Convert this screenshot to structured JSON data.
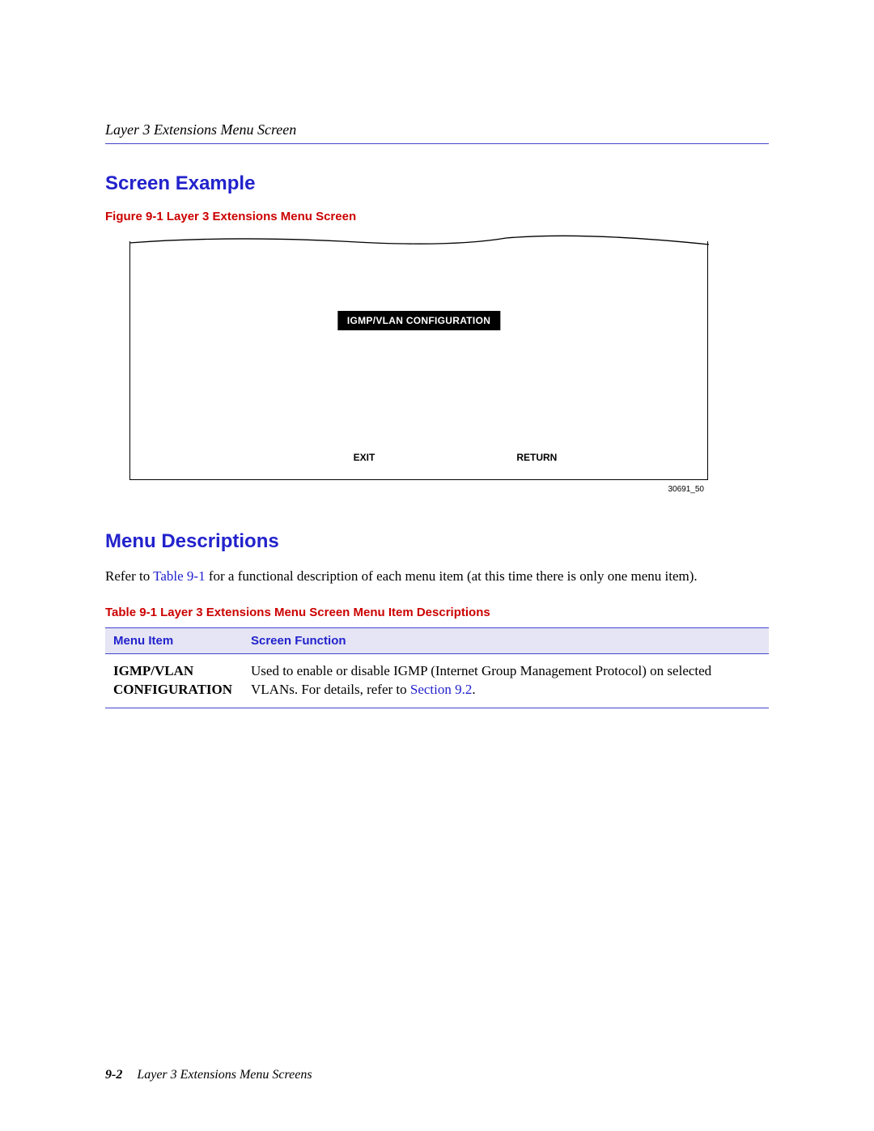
{
  "header": {
    "running_head": "Layer 3 Extensions Menu Screen"
  },
  "sections": {
    "screen_example": {
      "heading": "Screen Example",
      "figure_caption": "Figure 9-1    Layer 3 Extensions Menu Screen",
      "menu_item_label": "IGMP/VLAN CONFIGURATION",
      "exit_label": "EXIT",
      "return_label": "RETURN",
      "figure_id": "30691_50"
    },
    "menu_descriptions": {
      "heading": "Menu Descriptions",
      "intro_pre": "Refer to ",
      "intro_link": "Table 9-1",
      "intro_post": " for a functional description of each menu item (at this time there is only one menu item).",
      "table_caption": "Table 9-1    Layer 3 Extensions Menu Screen Menu Item Descriptions",
      "table_header_col1": "Menu Item",
      "table_header_col2": "Screen Function",
      "row1": {
        "menu_item": "IGMP/VLAN CONFIGURATION",
        "desc_pre": "Used to enable or disable IGMP (Internet Group Management Protocol) on selected VLANs. For details, refer to ",
        "desc_link": "Section 9.2",
        "desc_post": "."
      }
    }
  },
  "footer": {
    "page_number": "9-2",
    "title": "Layer 3 Extensions Menu Screens"
  }
}
